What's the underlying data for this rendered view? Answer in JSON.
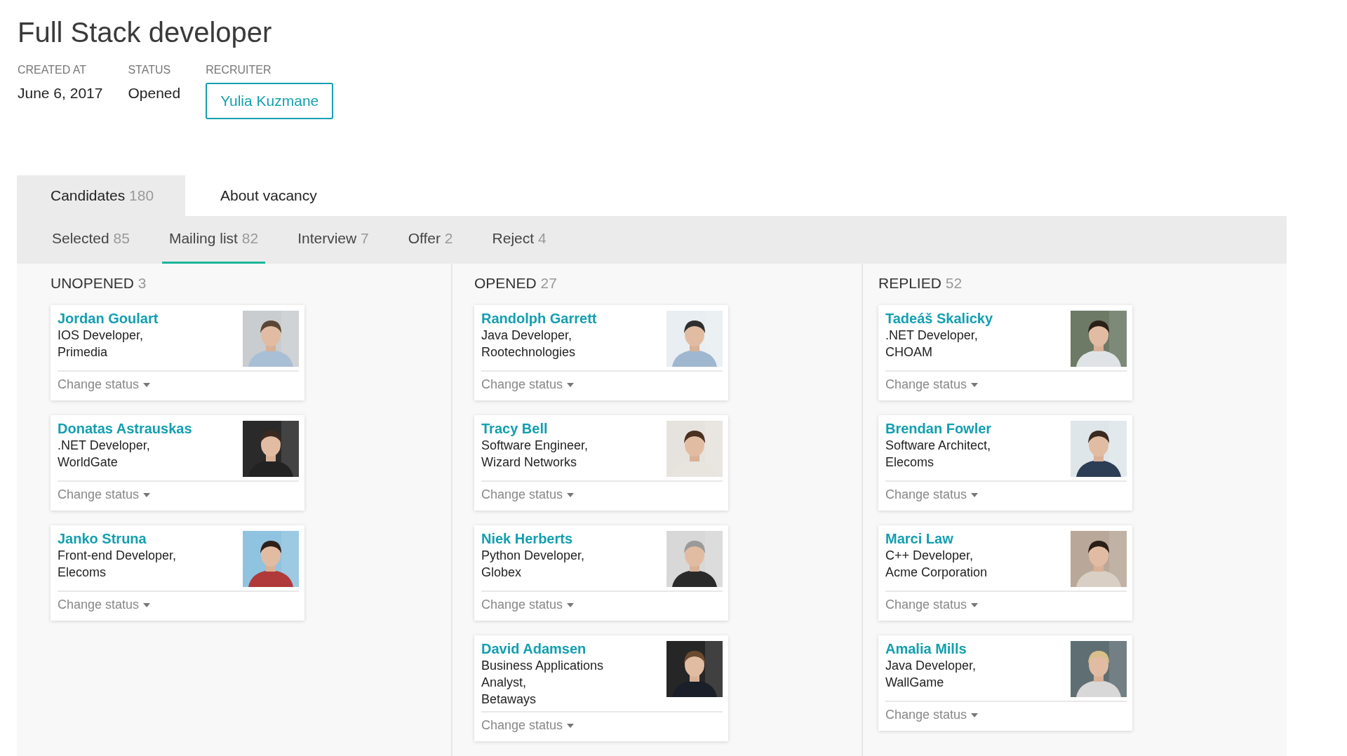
{
  "vacancy": {
    "title": "Full Stack developer",
    "fields": [
      {
        "label": "CREATED AT",
        "value": "June 6, 2017",
        "kind": "text"
      },
      {
        "label": "STATUS",
        "value": "Opened",
        "kind": "text"
      },
      {
        "label": "RECRUITER",
        "value": "Yulia Kuzmane",
        "kind": "button"
      }
    ]
  },
  "tabs": [
    {
      "label": "Candidates",
      "count": "180",
      "selected": true
    },
    {
      "label": "About vacancy",
      "selected": false
    }
  ],
  "subtabs": [
    {
      "label": "Selected",
      "count": "85",
      "selected": false
    },
    {
      "label": "Mailing list",
      "count": "82",
      "selected": true
    },
    {
      "label": "Interview",
      "count": "7",
      "selected": false
    },
    {
      "label": "Offer",
      "count": "2",
      "selected": false
    },
    {
      "label": "Reject",
      "count": "4",
      "selected": false
    }
  ],
  "columns": [
    {
      "title": "UNOPENED",
      "count": "3",
      "cards": [
        {
          "name": "Jordan Goulart",
          "role": "IOS Developer,",
          "company": "Primedia",
          "action": "Change status"
        },
        {
          "name": "Donatas Astrauskas",
          "role": ".NET Developer,",
          "company": "WorldGate",
          "action": "Change status"
        },
        {
          "name": "Janko Struna",
          "role": "Front-end Developer,",
          "company": "Elecoms",
          "action": "Change status"
        }
      ]
    },
    {
      "title": "OPENED",
      "count": "27",
      "cards": [
        {
          "name": "Randolph Garrett",
          "role": "Java Developer,",
          "company": "Rootechnologies",
          "action": "Change status"
        },
        {
          "name": "Tracy Bell",
          "role": "Software Engineer,",
          "company": "Wizard Networks",
          "action": "Change status"
        },
        {
          "name": "Niek Herberts",
          "role": "Python Developer,",
          "company": "Globex",
          "action": "Change status"
        },
        {
          "name": "David Adamsen",
          "role": "Business Applications Analyst,",
          "company": "Betaways",
          "action": "Change status"
        }
      ]
    },
    {
      "title": "REPLIED",
      "count": "52",
      "cards": [
        {
          "name": "Tadeáš Skalicky",
          "role": ".NET Developer,",
          "company": "CHOAM",
          "action": "Change status"
        },
        {
          "name": "Brendan Fowler",
          "role": "Software Architect,",
          "company": "Elecoms",
          "action": "Change status"
        },
        {
          "name": "Marci Law",
          "role": "C++ Developer,",
          "company": "Acme Corporation",
          "action": "Change status"
        },
        {
          "name": "Amalia Mills",
          "role": "Java Developer,",
          "company": "WallGame",
          "action": "Change status"
        }
      ]
    }
  ]
}
